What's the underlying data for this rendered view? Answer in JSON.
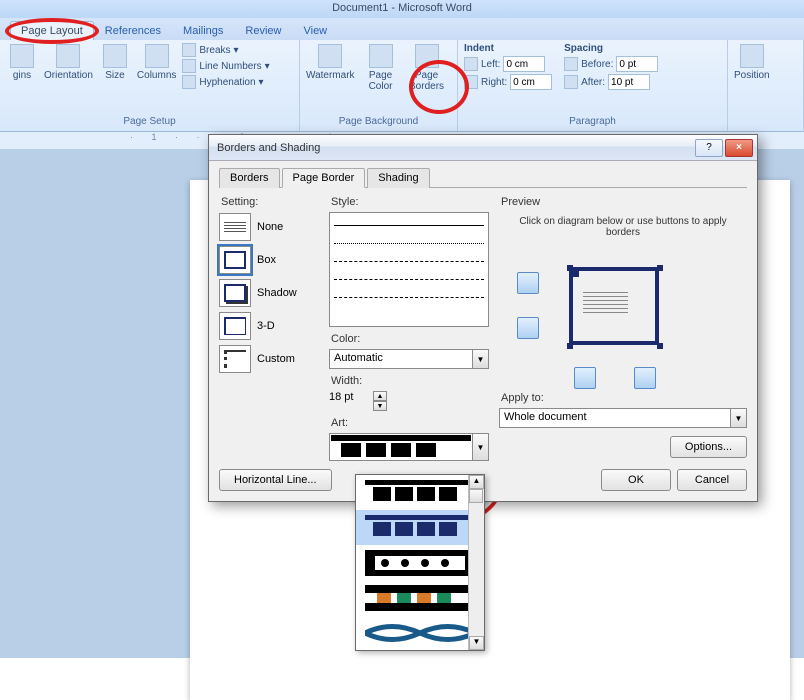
{
  "app_title": "Document1 - Microsoft Word",
  "tabs": {
    "page_layout": "Page Layout",
    "references": "References",
    "mailings": "Mailings",
    "review": "Review",
    "view": "View"
  },
  "ribbon": {
    "page_setup": {
      "label": "Page Setup",
      "margins": "gins",
      "orientation": "Orientation",
      "size": "Size",
      "columns": "Columns",
      "breaks": "Breaks",
      "line_numbers": "Line Numbers",
      "hyphenation": "Hyphenation"
    },
    "page_background": {
      "label": "Page Background",
      "watermark": "Watermark",
      "page_color": "Page\nColor",
      "page_borders": "Page\nBorders"
    },
    "indent": {
      "legend": "Indent",
      "left_lbl": "Left:",
      "left_val": "0 cm",
      "right_lbl": "Right:",
      "right_val": "0 cm"
    },
    "spacing": {
      "legend": "Spacing",
      "before_lbl": "Before:",
      "before_val": "0 pt",
      "after_lbl": "After:",
      "after_val": "10 pt"
    },
    "paragraph_label": "Paragraph",
    "position": "Position"
  },
  "ruler_text": "· 1 · · · 2 · · · 1 · · ·",
  "dialog": {
    "title": "Borders and Shading",
    "help": "?",
    "close": "×",
    "tabs": {
      "borders": "Borders",
      "page_border": "Page Border",
      "shading": "Shading"
    },
    "setting": {
      "legend": "Setting:",
      "none": "None",
      "box": "Box",
      "shadow": "Shadow",
      "threeD": "3-D",
      "custom": "Custom"
    },
    "style": {
      "legend": "Style:"
    },
    "color": {
      "legend": "Color:",
      "value": "Automatic"
    },
    "width": {
      "legend": "Width:",
      "value": "18 pt"
    },
    "art": {
      "legend": "Art:"
    },
    "preview": {
      "legend": "Preview",
      "hint": "Click on diagram below or use buttons to apply borders"
    },
    "apply_to": {
      "legend": "Apply to:",
      "value": "Whole document"
    },
    "options_btn": "Options...",
    "hline_btn": "Horizontal Line...",
    "ok": "OK",
    "cancel": "Cancel"
  }
}
